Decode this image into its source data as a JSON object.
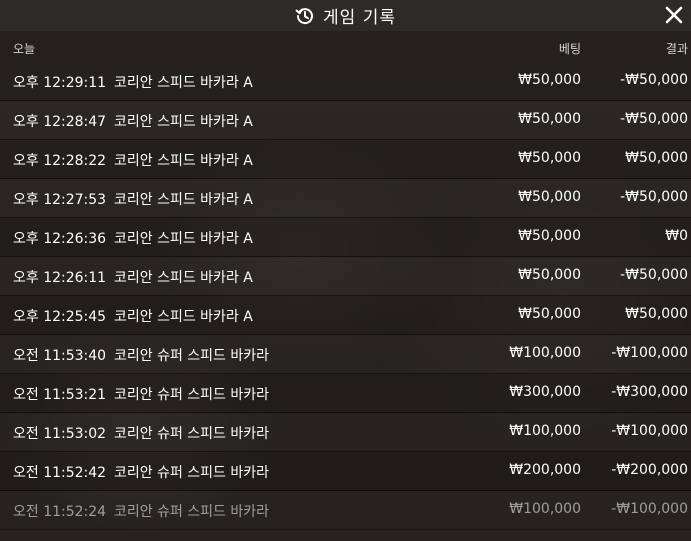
{
  "header": {
    "title": "게임 기록",
    "history_icon": "history-icon",
    "close_icon": "close-icon"
  },
  "columns": {
    "today": "오늘",
    "bet": "베팅",
    "result": "결과"
  },
  "rows": [
    {
      "time": "오후 12:29:11",
      "game": "코리안 스피드 바카라 A",
      "bet": "₩50,000",
      "result": "-₩50,000"
    },
    {
      "time": "오후 12:28:47",
      "game": "코리안 스피드 바카라 A",
      "bet": "₩50,000",
      "result": "-₩50,000"
    },
    {
      "time": "오후 12:28:22",
      "game": "코리안 스피드 바카라 A",
      "bet": "₩50,000",
      "result": "₩50,000"
    },
    {
      "time": "오후 12:27:53",
      "game": "코리안 스피드 바카라 A",
      "bet": "₩50,000",
      "result": "-₩50,000"
    },
    {
      "time": "오후 12:26:36",
      "game": "코리안 스피드 바카라 A",
      "bet": "₩50,000",
      "result": "₩0"
    },
    {
      "time": "오후 12:26:11",
      "game": "코리안 스피드 바카라 A",
      "bet": "₩50,000",
      "result": "-₩50,000"
    },
    {
      "time": "오후 12:25:45",
      "game": "코리안 스피드 바카라 A",
      "bet": "₩50,000",
      "result": "₩50,000"
    },
    {
      "time": "오전 11:53:40",
      "game": "코리안 슈퍼 스피드 바카라",
      "bet": "₩100,000",
      "result": "-₩100,000"
    },
    {
      "time": "오전 11:53:21",
      "game": "코리안 슈퍼 스피드 바카라",
      "bet": "₩300,000",
      "result": "-₩300,000"
    },
    {
      "time": "오전 11:53:02",
      "game": "코리안 슈퍼 스피드 바카라",
      "bet": "₩100,000",
      "result": "-₩100,000"
    },
    {
      "time": "오전 11:52:42",
      "game": "코리안 슈퍼 스피드 바카라",
      "bet": "₩200,000",
      "result": "-₩200,000"
    },
    {
      "time": "오전 11:52:24",
      "game": "코리안 슈퍼 스피드 바카라",
      "bet": "₩100,000",
      "result": "-₩100,000"
    }
  ]
}
